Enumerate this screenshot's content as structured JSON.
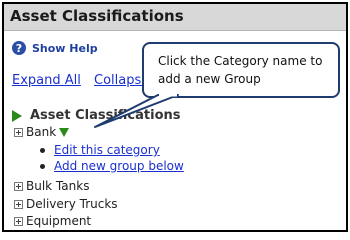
{
  "panel": {
    "title": "Asset Classifications"
  },
  "help": {
    "label": "Show Help",
    "icon": "question-icon"
  },
  "tree_controls": {
    "expand_all": "Expand All",
    "collapse_all": "Collapse All"
  },
  "tree": {
    "root_label": "Asset Classifications",
    "categories": [
      {
        "label": "Bank",
        "expanded": true,
        "actions": [
          "Edit this category",
          "Add new group below"
        ]
      },
      {
        "label": "Bulk Tanks",
        "expanded": false
      },
      {
        "label": "Delivery Trucks",
        "expanded": false
      },
      {
        "label": "Equipment",
        "expanded": false
      }
    ]
  },
  "callout": {
    "text": "Click  the Category name to add a new Group"
  },
  "colors": {
    "link": "#1a2fd0",
    "arrow": "#2a8a1a",
    "title_bar": "#d8d8d8",
    "callout_border": "#1f3c6e"
  }
}
